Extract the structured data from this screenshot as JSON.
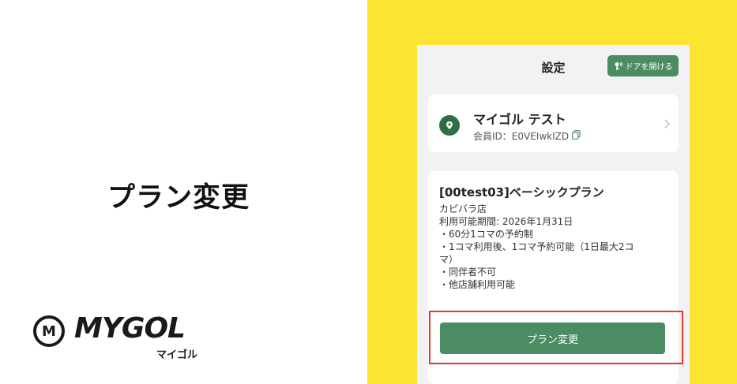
{
  "slide": {
    "title": "プラン変更"
  },
  "logo": {
    "mark_letter": "M",
    "text": "MYGOL",
    "kana": "マイゴル"
  },
  "app": {
    "header": {
      "title": "設定",
      "door_button_label": "ドアを開ける"
    },
    "profile": {
      "name": "マイゴル テスト",
      "member_id_label": "会員ID：E0VEIwkIZD"
    },
    "plan": {
      "title": "[00test03]ベーシックプラン",
      "lines": [
        "カピバラ店",
        "利用可能期間: 2026年1月31日",
        "・60分1コマの予約制",
        "・1コマ利用後、1コマ予約可能（1日最大2コ",
        "マ）",
        "・同伴者不可",
        "・他店舗利用可能"
      ],
      "change_button_label": "プラン変更"
    }
  },
  "colors": {
    "yellow": "#fbe432",
    "green": "#4c8c63",
    "highlight": "#e0392c"
  }
}
